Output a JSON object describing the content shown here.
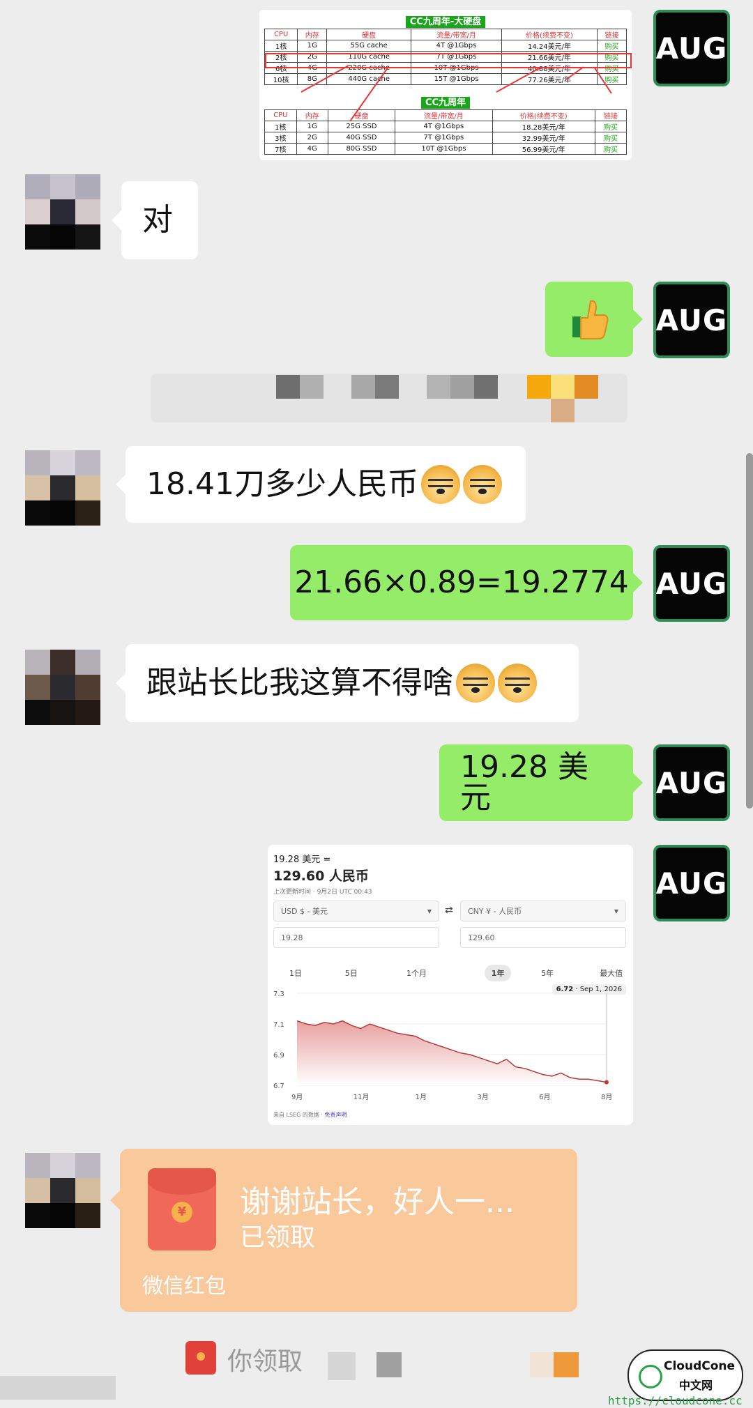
{
  "colors": {
    "background": "#ededed",
    "green_bubble": "#95ec69",
    "white_bubble": "#ffffff",
    "avatar_border": "#2e8b57",
    "red_packet": "#f9c99b"
  },
  "self_avatar": {
    "label": "AUG"
  },
  "messages": {
    "m1_text": "对",
    "m2_emoji": "thumbs-up",
    "m3_text": "18.41刀多少人民币",
    "m4_text": "21.66×0.89=19.2774",
    "m5_text": "跟站长比我这算不得啥",
    "m6_text": "19.28 美元"
  },
  "table_image": {
    "title1": "CC九周年-大硬盘",
    "title2": "CC九周年",
    "headers": [
      "CPU",
      "内存",
      "硬盘",
      "流量/带宽/月",
      "价格(续费不变)",
      "链接"
    ],
    "rows1": [
      [
        "1核",
        "1G",
        "55G cache",
        "4T @1Gbps",
        "14.24美元/年",
        "购买"
      ],
      [
        "2核",
        "2G",
        "110G cache",
        "7T @1Gbps",
        "21.66美元/年",
        "购买"
      ],
      [
        "6核",
        "4G",
        "220G cache",
        "10T @1Gbps",
        "40.88美元/年",
        "购买"
      ],
      [
        "10核",
        "8G",
        "440G cache",
        "15T @1Gbps",
        "77.26美元/年",
        "购买"
      ]
    ],
    "rows2": [
      [
        "1核",
        "1G",
        "25G SSD",
        "4T @1Gbps",
        "18.28美元/年",
        "购买"
      ],
      [
        "3核",
        "2G",
        "40G SSD",
        "7T @1Gbps",
        "32.99美元/年",
        "购买"
      ],
      [
        "7核",
        "4G",
        "80G SSD",
        "10T @1Gbps",
        "56.99美元/年",
        "购买"
      ]
    ]
  },
  "fx_image": {
    "from_line": "19.28 美元 =",
    "result": "129.60 人民币",
    "updated": "上次更新时间 · 9月2日 UTC 00:43",
    "from_currency": "USD $ - 美元",
    "to_currency": "CNY ¥ - 人民币",
    "swap_glyph": "⇄",
    "from_amount": "19.28",
    "to_amount": "129.60",
    "ranges": [
      "1日",
      "5日",
      "1个月",
      "1年",
      "5年",
      "最大值"
    ],
    "active_range": "1年",
    "tooltip_value": "6.72",
    "tooltip_date": "Sep 1, 2026",
    "source": "来自 LSEG 的数据",
    "disclaimer": "免责声明"
  },
  "chart_data": {
    "type": "area",
    "y_ticks": [
      "7.3",
      "7.1",
      "6.9",
      "6.7"
    ],
    "ylim": [
      6.7,
      7.3
    ],
    "x_ticks": [
      "9月",
      "11月",
      "1月",
      "3月",
      "6月",
      "8月"
    ],
    "values": [
      7.12,
      7.1,
      7.09,
      7.11,
      7.1,
      7.12,
      7.09,
      7.07,
      7.1,
      7.08,
      7.06,
      7.04,
      7.03,
      7.02,
      6.99,
      6.97,
      6.95,
      6.93,
      6.91,
      6.9,
      6.88,
      6.86,
      6.84,
      6.87,
      6.82,
      6.81,
      6.79,
      6.77,
      6.76,
      6.78,
      6.75,
      6.74,
      6.74,
      6.73,
      6.72
    ]
  },
  "red_packet": {
    "title": "谢谢站长，好人一...",
    "status": "已领取",
    "footer": "微信红包",
    "coin_glyph": "¥"
  },
  "system_notice": {
    "text": "你领取"
  },
  "watermark": {
    "brand": "CloudCone",
    "cn": "中文网",
    "url": "https://cloudcone.cc"
  }
}
